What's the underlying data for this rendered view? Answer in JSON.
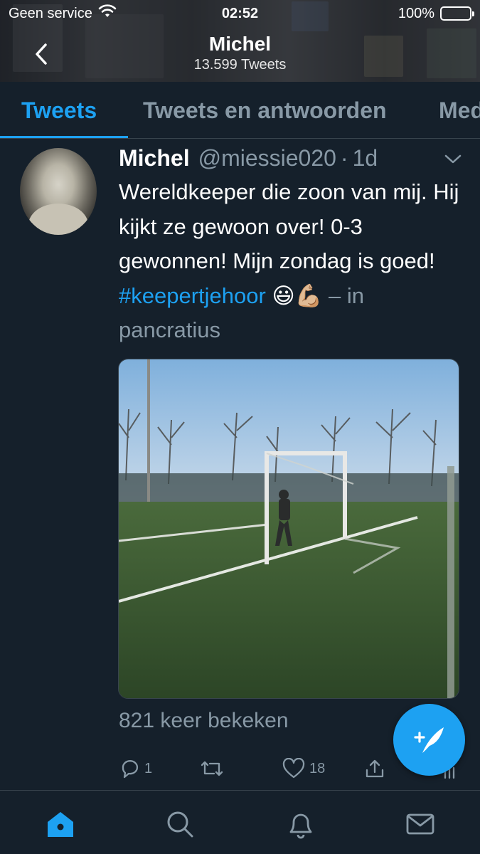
{
  "status_bar": {
    "carrier": "Geen service",
    "time": "02:52",
    "battery_percent": "100%"
  },
  "header": {
    "title": "Michel",
    "subtitle": "13.599 Tweets"
  },
  "tabs": [
    {
      "label": "Tweets",
      "active": true
    },
    {
      "label": "Tweets en antwoorden",
      "active": false
    },
    {
      "label": "Media",
      "active": false
    }
  ],
  "tweet": {
    "name": "Michel",
    "handle": "@miessie020",
    "separator": "·",
    "time": "1d",
    "text_main": "Wereldkeeper die zoon van mij. Hij kijkt ze gewoon over! 0-3 gewonnen! Mijn zondag is goed! ",
    "hashtag": "#keepertjehoor",
    "emoji": " 😃💪🏼 ",
    "location_prefix": "– in pancratius",
    "views": "821 keer bekeken",
    "reply_count": "1",
    "retweet_count": "",
    "like_count": "18"
  },
  "colors": {
    "background": "#15202b",
    "accent": "#1da1f2",
    "muted": "#8899a6",
    "divider": "#38444d"
  },
  "icons": {
    "back": "chevron-left-icon",
    "caret": "chevron-down-icon",
    "reply": "reply-icon",
    "retweet": "retweet-icon",
    "like": "heart-icon",
    "share": "share-icon",
    "compose": "compose-tweet-icon",
    "home": "home-icon",
    "search": "search-icon",
    "notifications": "bell-icon",
    "messages": "mail-icon"
  }
}
